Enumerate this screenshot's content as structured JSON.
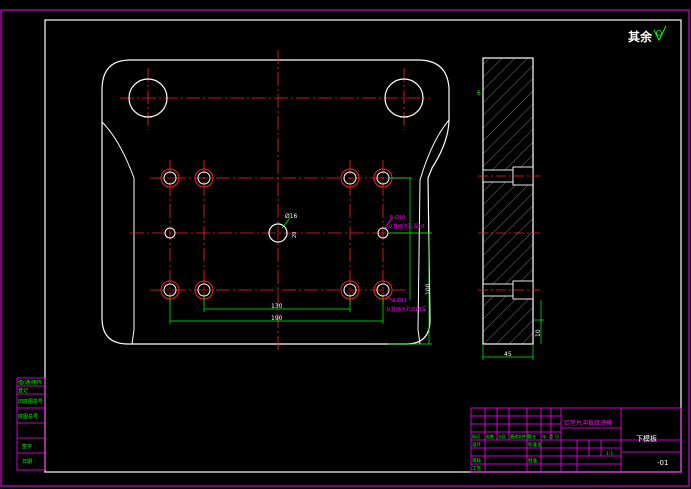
{
  "drawing": {
    "roughness_symbol": "其余",
    "part_name": "下模板",
    "part_code": "-01",
    "assembly_title": "铝垫片冲裁级进模",
    "scale": "1:1"
  },
  "front_view": {
    "hole_center_label": "Ø16",
    "hole_center_dim": "20",
    "dim_bottom_inner": "130",
    "dim_bottom_outer": "190",
    "dim_right": "100",
    "note_upper_a": "6-Ø10",
    "note_upper_b": "从背面沉孔深10",
    "note_lower_a": "4-Ø11",
    "note_lower_b": "从背面沉孔Ø18深"
  },
  "side_view": {
    "dim_bottom": "45",
    "dim_top_left": "6",
    "dim_right": "10"
  },
  "left_stamp_rows": [
    "借(通)用件",
    "登记",
    "旧底图总号",
    "底图总号",
    "签字",
    "日期"
  ],
  "title_block": {
    "row_labels": [
      "标记",
      "处数",
      "分区",
      "更改文件号",
      "签名",
      "年",
      "月",
      "日"
    ],
    "design": "设计",
    "check": "审核",
    "process": "工艺",
    "approve": "批准",
    "standard": "标准化"
  },
  "colors": {
    "background": "#000000",
    "frame": "#ff00ff",
    "outline": "#ffffff",
    "center_line": "#ff2020",
    "dimension": "#00ff00",
    "annotation": "#ff00ff"
  }
}
